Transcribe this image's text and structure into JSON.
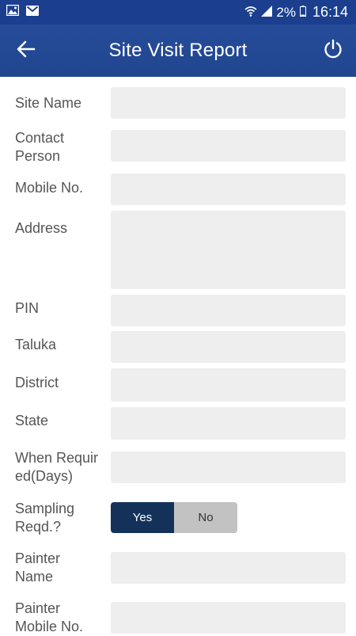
{
  "status_bar": {
    "battery": "2%",
    "time": "16:14",
    "icons": [
      "image-icon",
      "gmail-icon",
      "wifi-icon",
      "signal-icon",
      "battery-icon"
    ]
  },
  "app_bar": {
    "title": "Site Visit Report",
    "back_icon": "arrow-left-icon",
    "power_icon": "power-icon"
  },
  "form": {
    "site_name": {
      "label": "Site Name",
      "value": ""
    },
    "contact_person": {
      "label": "Contact Person",
      "value": ""
    },
    "mobile_no": {
      "label": "Mobile No.",
      "value": ""
    },
    "address": {
      "label": "Address",
      "value": ""
    },
    "pin": {
      "label": "PIN",
      "value": ""
    },
    "taluka": {
      "label": "Taluka",
      "value": ""
    },
    "district": {
      "label": "District",
      "value": ""
    },
    "state": {
      "label": "State",
      "value": ""
    },
    "when_required": {
      "label": "When Requir ed(Days)",
      "value": ""
    },
    "sampling": {
      "label": "Sampling Reqd.?",
      "yes": "Yes",
      "no": "No",
      "selected": "Yes"
    },
    "painter_name": {
      "label": "Painter Name",
      "value": ""
    },
    "painter_mobile": {
      "label": "Painter Mobile No.",
      "value": ""
    }
  },
  "colors": {
    "status_bar": "#1b3f8e",
    "app_bar": "#264c9a",
    "field_bg": "#eeeeee",
    "toggle_selected": "#143259",
    "toggle_unselected": "#c2c2c2",
    "label_text": "#555555"
  }
}
